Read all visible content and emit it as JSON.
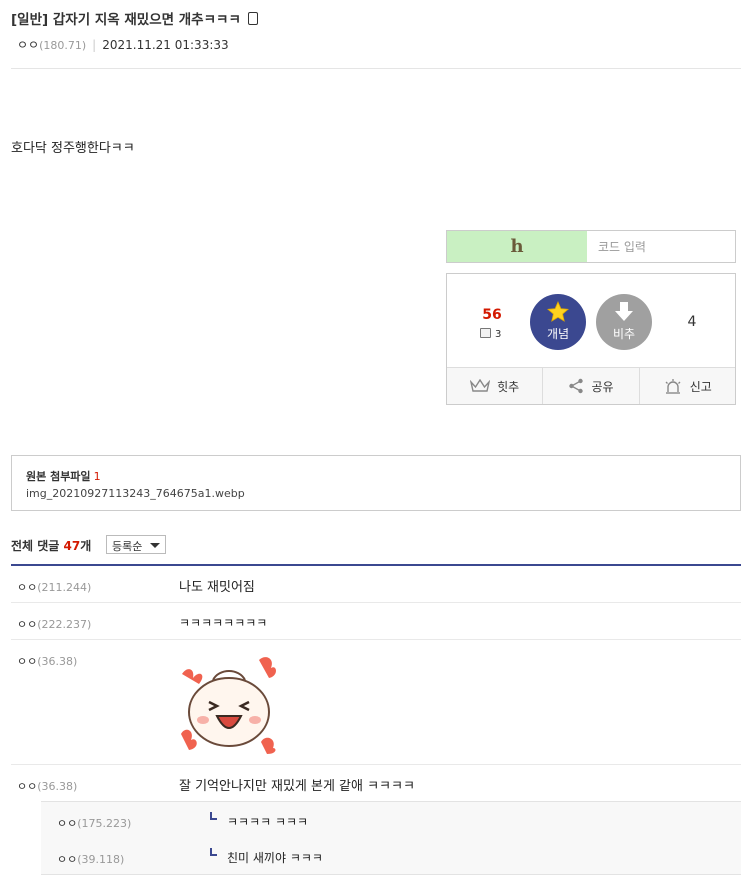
{
  "post": {
    "title": "[일반] 갑자기 지옥 재밌으면 개추ㅋㅋㅋ",
    "author": "ㅇㅇ",
    "author_ip": "(180.71)",
    "date": "2021.11.21 01:33:33",
    "body": "호다닥 정주행한다ㅋㅋ"
  },
  "captcha": {
    "image_text": "h",
    "placeholder": "코드 입력"
  },
  "vote": {
    "up_count": "56",
    "fix_count": "3",
    "up_label": "개념",
    "down_label": "비추",
    "down_count": "4",
    "actions": [
      "힛추",
      "공유",
      "신고"
    ]
  },
  "attachment": {
    "label": "원본 첨부파일",
    "count": "1",
    "filename": "img_20210927113243_764675a1.webp"
  },
  "comments": {
    "label_prefix": "전체 댓글",
    "count": "47",
    "label_suffix": "개",
    "sort": "등록순",
    "items": [
      {
        "nick": "ㅇㅇ",
        "ip": "(211.244)",
        "text": "나도 재밋어짐"
      },
      {
        "nick": "ㅇㅇ",
        "ip": "(222.237)",
        "text": "ㅋㅋㅋㅋㅋㅋㅋㅋ"
      },
      {
        "nick": "ㅇㅇ",
        "ip": "(36.38)",
        "text": ""
      },
      {
        "nick": "ㅇㅇ",
        "ip": "(36.38)",
        "text": "잘 기억안나지만 재밌게 본게 같애 ㅋㅋㅋㅋ"
      }
    ],
    "replies": [
      {
        "nick": "ㅇㅇ",
        "ip": "(175.223)",
        "text": "ㅋㅋㅋㅋ ㅋㅋㅋ"
      },
      {
        "nick": "ㅇㅇ",
        "ip": "(39.118)",
        "text": "친미 새끼야 ㅋㅋㅋ"
      }
    ]
  }
}
